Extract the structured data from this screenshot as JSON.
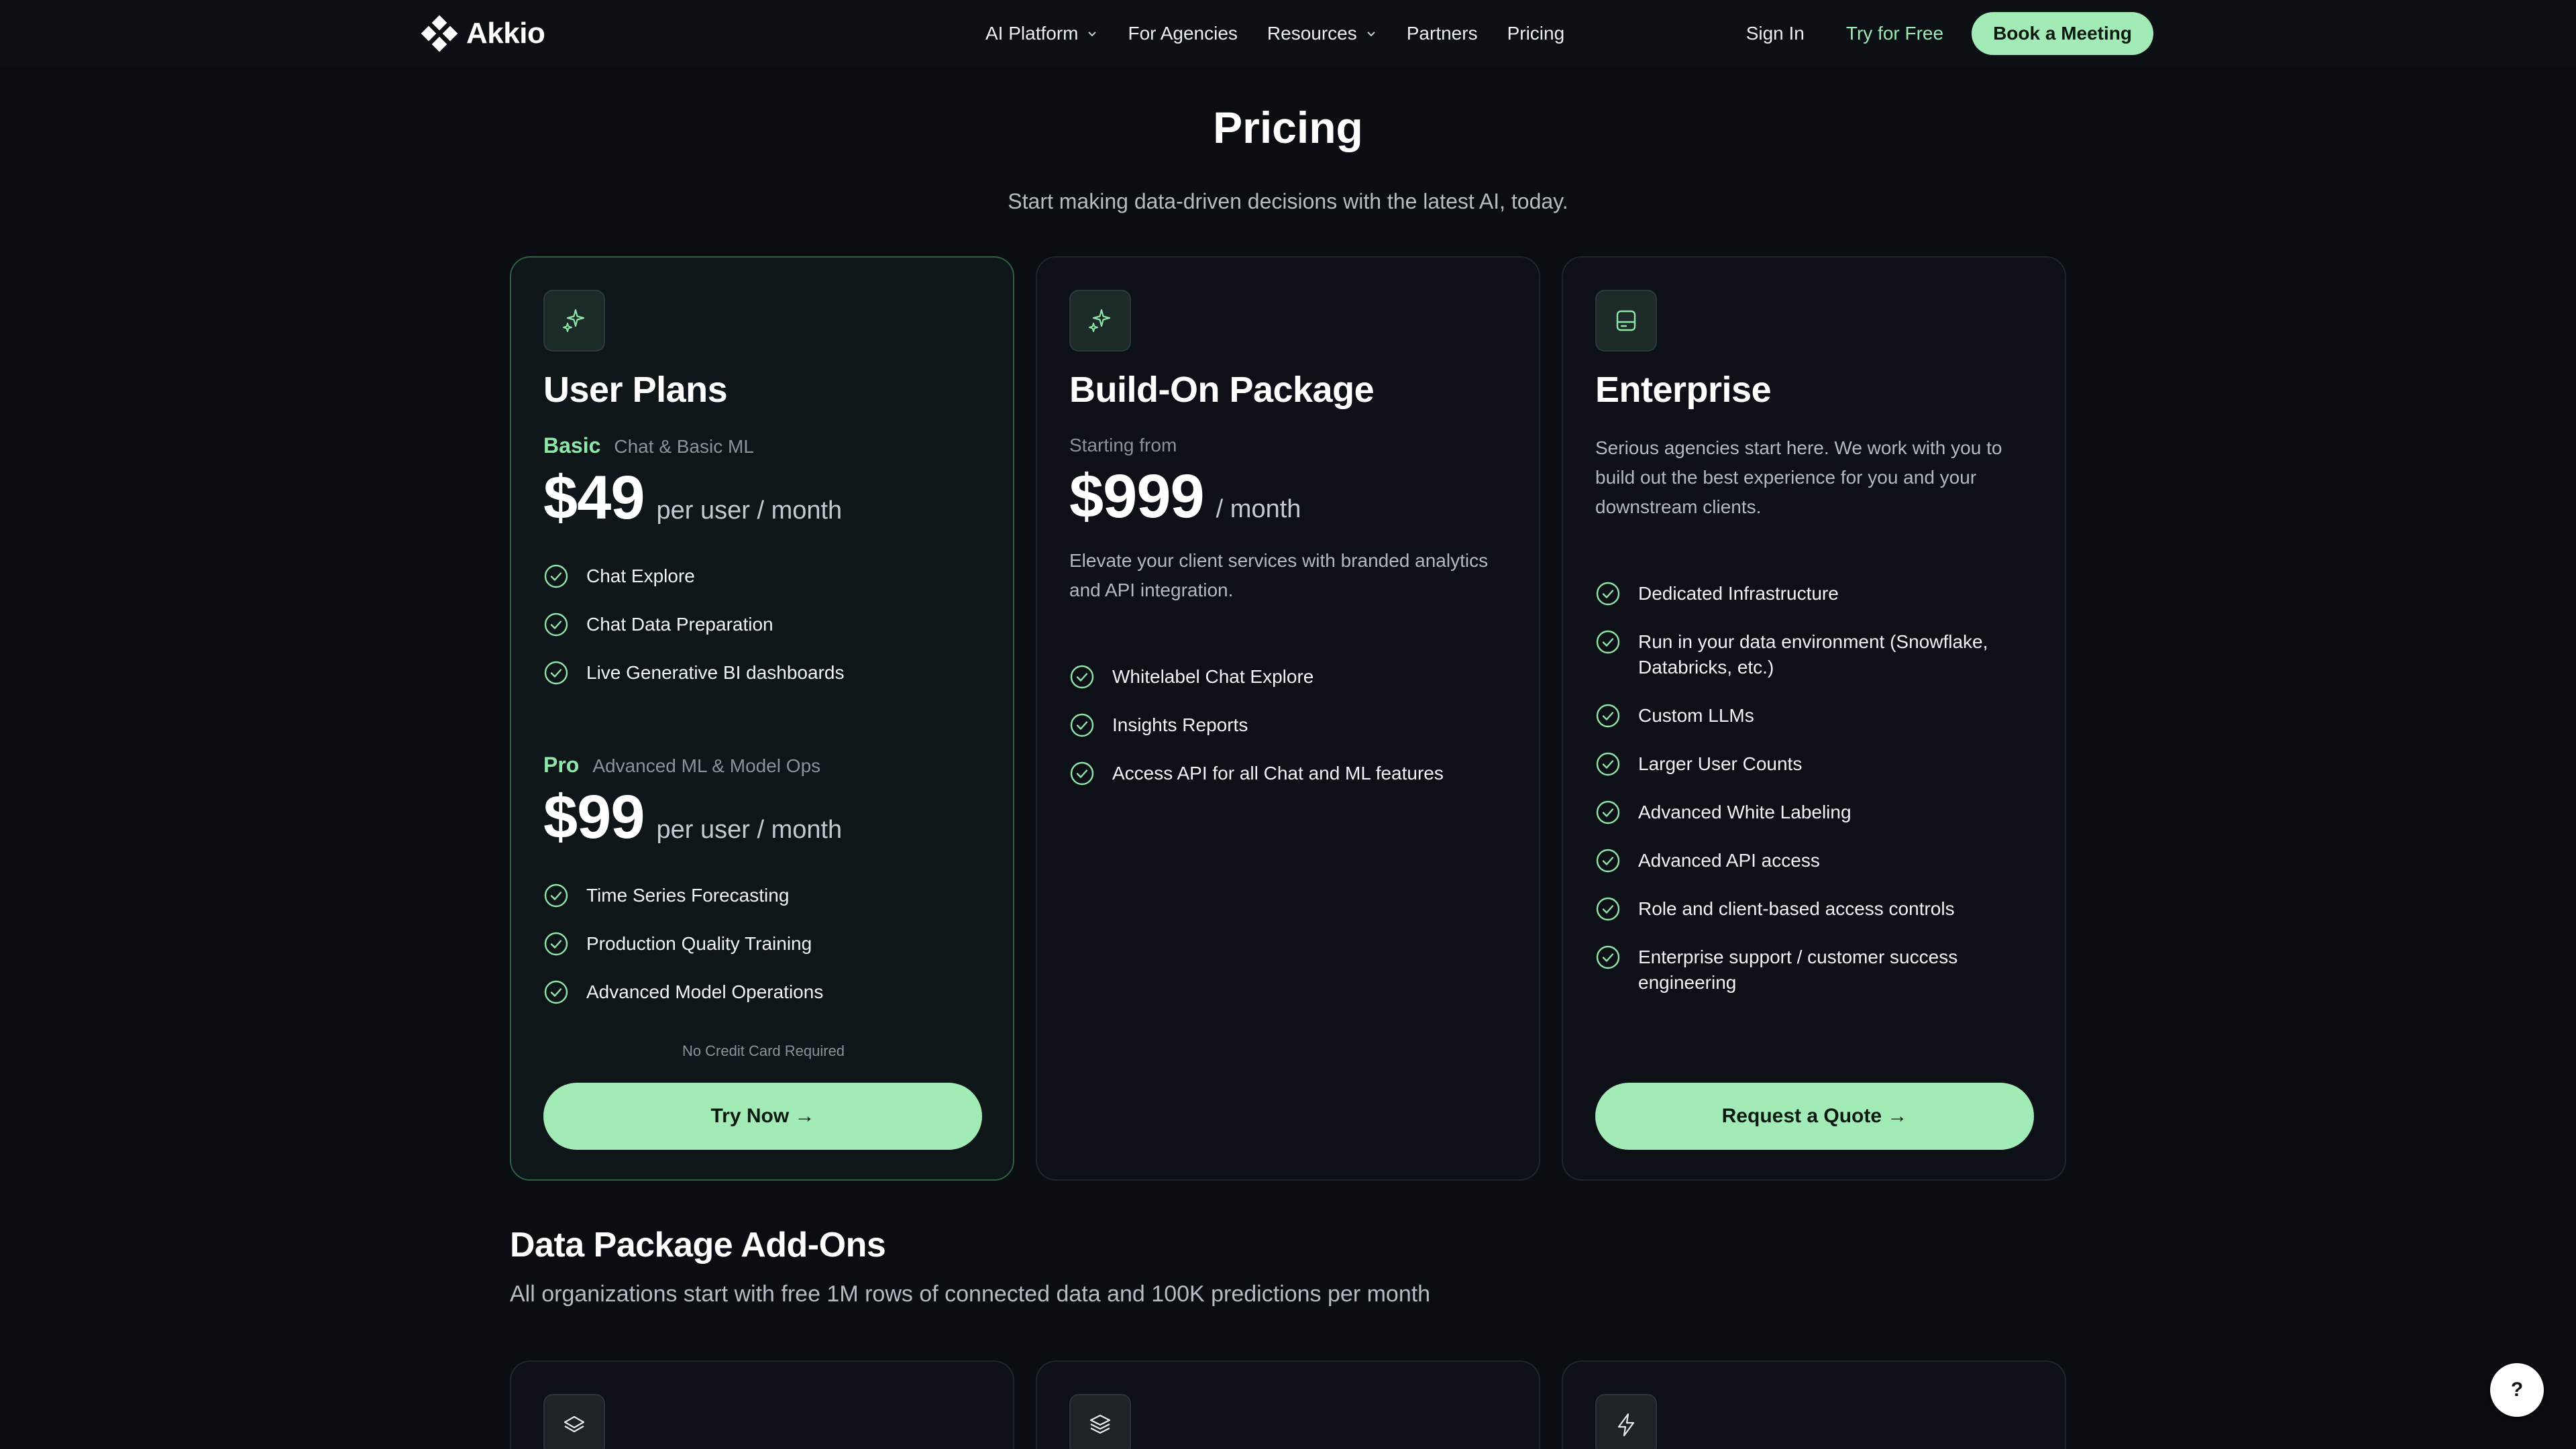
{
  "brand": {
    "name": "Akkio",
    "logo_icon": "diamond-cluster-icon"
  },
  "nav": {
    "links": [
      {
        "label": "AI Platform",
        "dropdown": true
      },
      {
        "label": "For Agencies",
        "dropdown": false
      },
      {
        "label": "Resources",
        "dropdown": true
      },
      {
        "label": "Partners",
        "dropdown": false
      },
      {
        "label": "Pricing",
        "dropdown": false
      }
    ],
    "sign_in": "Sign In",
    "try_free": "Try for Free",
    "book_meeting": "Book a Meeting"
  },
  "hero": {
    "title": "Pricing",
    "subtitle": "Start making data-driven decisions with the latest AI, today."
  },
  "plans": [
    {
      "icon": "sparkles-icon",
      "title": "User Plans",
      "tiers": [
        {
          "name": "Basic",
          "desc": "Chat & Basic ML",
          "price": "$49",
          "unit": "per user / month",
          "features": [
            "Chat Explore",
            "Chat Data Preparation",
            "Live Generative BI dashboards"
          ]
        },
        {
          "name": "Pro",
          "desc": "Advanced ML & Model Ops",
          "price": "$99",
          "unit": "per user / month",
          "features": [
            "Time Series Forecasting",
            "Production Quality Training",
            "Advanced Model Operations"
          ]
        }
      ],
      "note": "No Credit Card Required",
      "cta": "Try Now →"
    },
    {
      "icon": "sparkles-icon",
      "title": "Build-On Package",
      "starting": "Starting from",
      "price": "$999",
      "unit": "/ month",
      "desc": "Elevate your client services with branded analytics and API integration.",
      "features": [
        "Whitelabel Chat Explore",
        "Insights Reports",
        "Access API for all Chat and ML features"
      ]
    },
    {
      "icon": "server-icon",
      "title": "Enterprise",
      "desc": "Serious agencies start here. We work with you to build out the best experience for you and your downstream clients.",
      "features": [
        "Dedicated Infrastructure",
        "Run in your data environment (Snowflake, Databricks, etc.)",
        "Custom LLMs",
        "Larger User Counts",
        "Advanced White Labeling",
        "Advanced API access",
        "Role and client-based access controls",
        "Enterprise support / customer success engineering"
      ],
      "cta": "Request a Quote →"
    }
  ],
  "addons": {
    "title": "Data Package Add-Ons",
    "subtitle": "All organizations start with free 1M rows of connected data and 100K predictions per month",
    "icons": [
      "layers-icon",
      "stack-icon",
      "lightning-icon"
    ]
  },
  "help_label": "?",
  "colors": {
    "accent": "#a2ebb6",
    "background": "#0a0d12",
    "card": "#0d1117"
  }
}
